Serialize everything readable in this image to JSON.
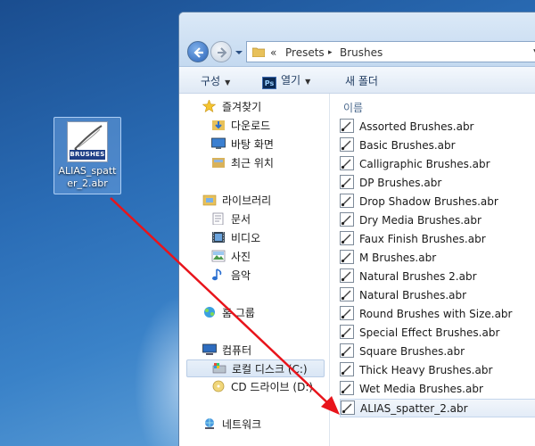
{
  "desktop": {
    "icon_label": "ALIAS_spatter_2.abr",
    "icon_badge": "BRUSHES"
  },
  "address_bar": {
    "chevrons": "«",
    "crumbs": [
      "Presets",
      "Brushes"
    ],
    "separator": "▸"
  },
  "toolbar": {
    "organize": "구성",
    "open": "열기",
    "new_folder": "새 폴더"
  },
  "nav_pane": {
    "favorites": "즐겨찾기",
    "downloads": "다운로드",
    "desktop": "바탕 화면",
    "recent": "최근 위치",
    "libraries": "라이브러리",
    "documents": "문서",
    "videos": "비디오",
    "pictures": "사진",
    "music": "음악",
    "homegroup": "홈 그룹",
    "computer": "컴퓨터",
    "local_disk": "로컬 디스크 (C:)",
    "cd_drive": "CD 드라이브 (D:)",
    "network": "네트워크"
  },
  "file_pane": {
    "column_name": "이름",
    "files": [
      "Assorted Brushes.abr",
      "Basic Brushes.abr",
      "Calligraphic Brushes.abr",
      "DP Brushes.abr",
      "Drop Shadow Brushes.abr",
      "Dry Media Brushes.abr",
      "Faux Finish Brushes.abr",
      "M Brushes.abr",
      "Natural Brushes 2.abr",
      "Natural Brushes.abr",
      "Round Brushes with Size.abr",
      "Special Effect Brushes.abr",
      "Square Brushes.abr",
      "Thick Heavy Brushes.abr",
      "Wet Media Brushes.abr",
      "ALIAS_spatter_2.abr"
    ]
  },
  "colors": {
    "arrow": "#e8141b",
    "ps_badge": "Ps"
  }
}
